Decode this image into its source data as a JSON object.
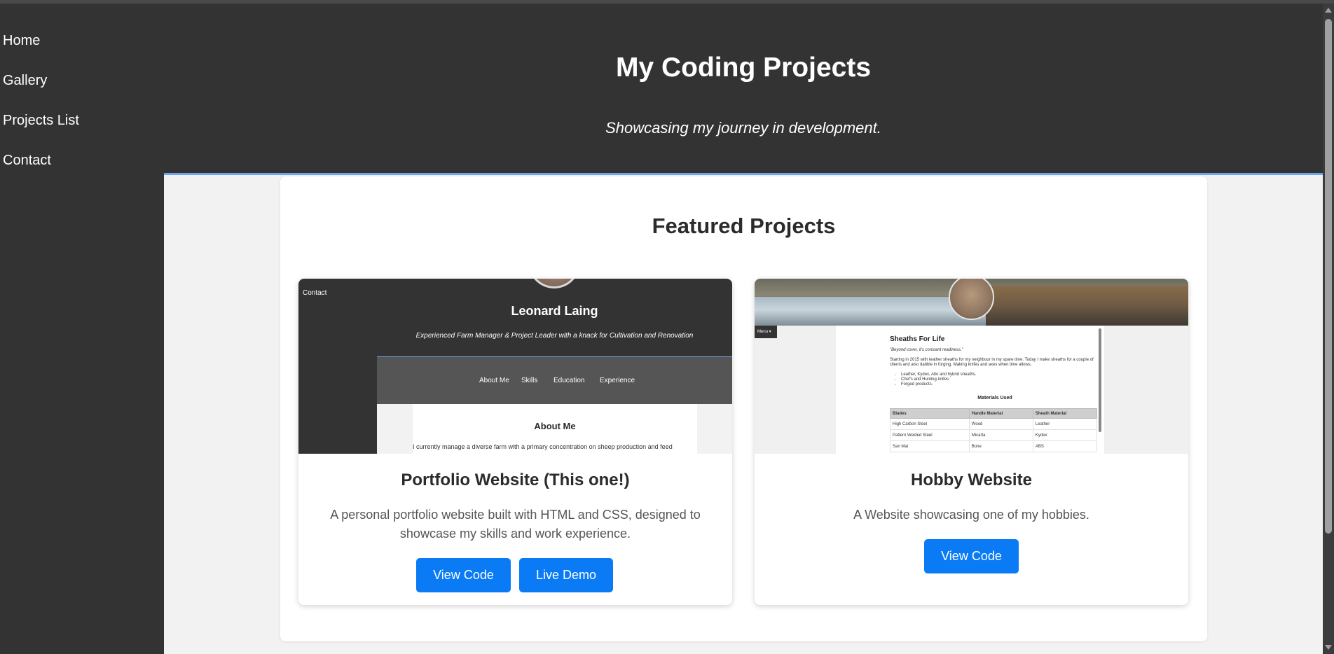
{
  "sidebar": {
    "items": [
      {
        "label": "Home"
      },
      {
        "label": "Gallery"
      },
      {
        "label": "Projects List"
      },
      {
        "label": "Contact"
      }
    ]
  },
  "header": {
    "title": "My Coding Projects",
    "tagline": "Showcasing my journey in development."
  },
  "main": {
    "section_title": "Featured Projects",
    "projects": [
      {
        "title": "Portfolio Website (This one!)",
        "description": "A personal portfolio website built with HTML and CSS, designed to showcase my skills and work experience.",
        "buttons": [
          "View Code",
          "Live Demo"
        ],
        "thumbnail": {
          "contact": "Contact",
          "name": "Leonard Laing",
          "tagline": "Experienced Farm Manager & Project Leader with a knack for Cultivation and Renovation",
          "nav": [
            "About Me",
            "Skills",
            "Education",
            "Experience"
          ],
          "heading": "About Me",
          "text": "I currently manage a diverse farm with a primary concentration on sheep production and feed"
        }
      },
      {
        "title": "Hobby Website",
        "description": "A Website showcasing one of my hobbies.",
        "buttons": [
          "View Code"
        ],
        "thumbnail": {
          "menu": "Menu ▾",
          "heading": "Sheaths For Life",
          "quote": "\"Beyond cover, it's constant readiness.\"",
          "intro": "Starting in 2015 with leather sheaths for my neighbour in my spare time. Today I make sheaths for a couple of clients and also dabble in forging. Making knifes and axes when time allows.",
          "bullets": [
            "Leather, Kydex, Alto and hybrid sheaths.",
            "Chef's and Hunting knifes.",
            "Forged products."
          ],
          "table_title": "Materials Used",
          "table_headers": [
            "Blades",
            "Handle Material",
            "Sheath Material"
          ],
          "table_rows": [
            [
              "High Carbon Steel",
              "Wood",
              "Leather"
            ],
            [
              "Pattern Welded Steel",
              "Micarta",
              "Kydex"
            ],
            [
              "San Mai",
              "Bone",
              "ABS"
            ]
          ]
        }
      }
    ]
  },
  "colors": {
    "background_dark": "#333333",
    "content_bg": "#f2f2f2",
    "accent_line": "#6ea4ee",
    "button": "#0a7bf5"
  }
}
